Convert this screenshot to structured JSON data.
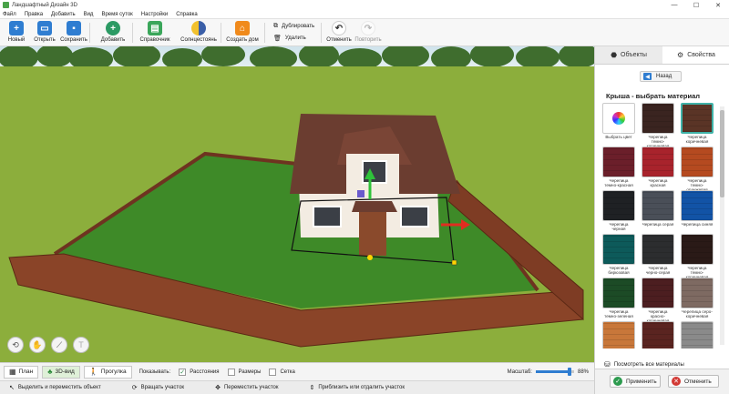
{
  "window": {
    "title": "Ландшафтный Дизайн 3D",
    "min": "—",
    "max": "☐",
    "close": "✕"
  },
  "menu": [
    "Файл",
    "Правка",
    "Добавить",
    "Вид",
    "Время суток",
    "Настройки",
    "Справка"
  ],
  "toolbar": {
    "new": "Новый",
    "open": "Открыть",
    "save": "Сохранить",
    "add": "Добавить",
    "guide": "Справочник",
    "sun": "Солнцестоянь",
    "build": "Создать дом",
    "duplicate": "Дублировать",
    "delete": "Удалить",
    "undo": "Отменить",
    "redo": "Повторить"
  },
  "panel": {
    "tab_objects": "Объекты",
    "tab_properties": "Свойства",
    "back": "Назад",
    "section_title": "Крыша - выбрать материал",
    "show_all": "Посмотреть все материалы",
    "apply": "Применить",
    "cancel": "Отменить",
    "materials": [
      {
        "label": "Выбрать цвет",
        "color": "#ffffff"
      },
      {
        "label": "Черепица темно-коричневая",
        "color": "#3a2420"
      },
      {
        "label": "Черепица коричневая",
        "color": "#5a3426"
      },
      {
        "label": "Черепица темно-красная",
        "color": "#6b1f2a"
      },
      {
        "label": "Черепица красная",
        "color": "#a8232c"
      },
      {
        "label": "Черепица темно-оранжевая",
        "color": "#b54a20"
      },
      {
        "label": "Черепица черная",
        "color": "#1f2124"
      },
      {
        "label": "Черепица серая",
        "color": "#4a4f58"
      },
      {
        "label": "Черепица синяя",
        "color": "#1253a6"
      },
      {
        "label": "Черепица бирюзовая",
        "color": "#0d5a5a"
      },
      {
        "label": "Черепица черно-серая",
        "color": "#2c2d2f"
      },
      {
        "label": "Черепица темно-коричневая",
        "color": "#2a1a17"
      },
      {
        "label": "Черепица темно-зеленая",
        "color": "#1c4b26"
      },
      {
        "label": "Черепица красно-коричневая",
        "color": "#4c1e20"
      },
      {
        "label": "Черепица серо-коричневая",
        "color": "#7e6a62"
      },
      {
        "label": "",
        "color": "#c8773a"
      },
      {
        "label": "",
        "color": "#5a2420"
      },
      {
        "label": "",
        "color": "#8a8a8a"
      }
    ]
  },
  "bottom": {
    "plan": "План",
    "view3d": "3D-вид",
    "walk": "Прогулка",
    "show": "Показывать:",
    "distance": "Расстояния",
    "sizes": "Размеры",
    "grid": "Сетка",
    "scale": "Масштаб:",
    "zoom_value": "88%",
    "zoom_fraction": 0.88
  },
  "status": {
    "select": "Выделить и переместить объект",
    "rotate": "Вращать участок",
    "move": "Переместить участок",
    "zoom": "Приблизить или отдалить участок"
  }
}
